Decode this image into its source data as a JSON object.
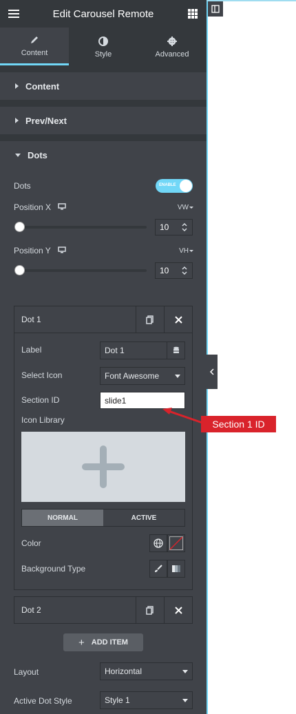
{
  "header": {
    "title": "Edit Carousel Remote"
  },
  "tabs": [
    {
      "label": "Content",
      "icon": "pencil-icon"
    },
    {
      "label": "Style",
      "icon": "contrast-icon"
    },
    {
      "label": "Advanced",
      "icon": "gear-icon"
    }
  ],
  "sections": {
    "content": "Content",
    "prev_next": "Prev/Next",
    "dots": "Dots"
  },
  "dots": {
    "enable_label": "Dots",
    "toggle_text": "ENABLE",
    "toggle_on": true,
    "position_x": {
      "label": "Position X",
      "unit": "VW",
      "value": "10",
      "slider_fraction": 0.0
    },
    "position_y": {
      "label": "Position Y",
      "unit": "VH",
      "value": "10",
      "slider_fraction": 0.0
    }
  },
  "items": [
    {
      "title": "Dot 1",
      "label_field": {
        "label": "Label",
        "value": "Dot 1"
      },
      "select_icon": {
        "label": "Select Icon",
        "value": "Font Awesome"
      },
      "section_id": {
        "label": "Section ID",
        "value": "slide1"
      },
      "icon_library_label": "Icon Library",
      "state_tabs": [
        "NORMAL",
        "ACTIVE"
      ],
      "color_label": "Color",
      "background_type_label": "Background Type"
    },
    {
      "title": "Dot 2"
    }
  ],
  "add_item_label": "ADD ITEM",
  "layout": {
    "label": "Layout",
    "value": "Horizontal"
  },
  "active_dot_style": {
    "label": "Active Dot Style",
    "value": "Style 1"
  },
  "annotation": {
    "text": "Section 1 ID",
    "color": "#d9232b"
  },
  "colors": {
    "accent": "#71d7f7",
    "panel": "#404349",
    "panel_dark": "#34383c"
  }
}
